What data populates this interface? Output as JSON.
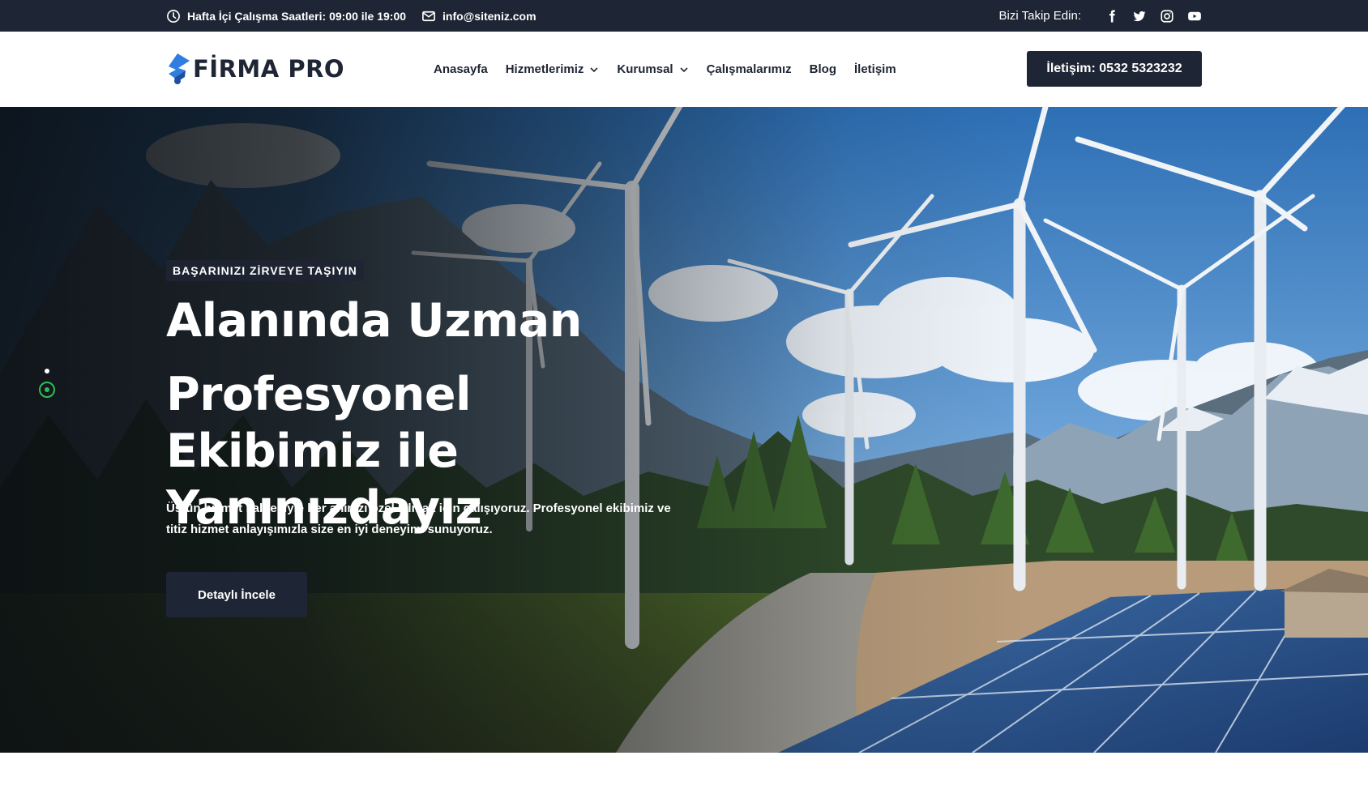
{
  "topbar": {
    "hours": "Hafta İçi Çalışma Saatleri: 09:00 ile 19:00",
    "email": "info@siteniz.com",
    "follow_label": "Bizi Takip Edin:",
    "social": [
      "facebook-icon",
      "twitter-icon",
      "instagram-icon",
      "youtube-icon"
    ]
  },
  "header": {
    "logo_text": "FİRMA PRO",
    "nav": [
      {
        "label": "Anasayfa",
        "dropdown": false
      },
      {
        "label": "Hizmetlerimiz",
        "dropdown": true
      },
      {
        "label": "Kurumsal",
        "dropdown": true
      },
      {
        "label": "Çalışmalarımız",
        "dropdown": false
      },
      {
        "label": "Blog",
        "dropdown": false
      },
      {
        "label": "İletişim",
        "dropdown": false
      }
    ],
    "cta_label": "İletişim: 0532 5323232"
  },
  "hero": {
    "eyebrow": "BAŞARINIZI ZİRVEYE TAŞIYIN",
    "title_line1": "Alanında Uzman",
    "title_line2": "Profesyonel Ekibimiz ile Yanınızdayız",
    "description": "Üstün hizmet kalitesiyle her anınızı özel kılmak için çalışıyoruz. Profesyonel ekibimiz ve titiz hizmet anlayışımızla size en iyi deneyimi sunuyoruz.",
    "button_label": "Detaylı İncele",
    "slides": 2,
    "active_slide": 2
  },
  "colors": {
    "dark": "#1e2534",
    "accent_blue": "#2f7ee0",
    "slider_active": "#2ebd59"
  }
}
